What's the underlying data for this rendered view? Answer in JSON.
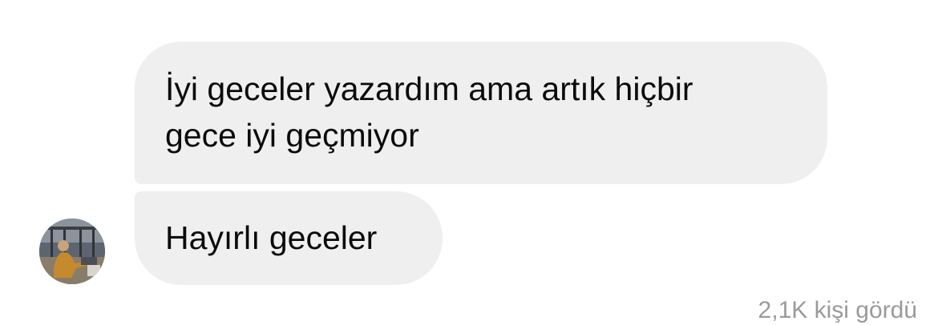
{
  "messages": [
    {
      "text_line_1": "İyi geceler yazardım ama artık hiçbir",
      "text_line_2": "gece iyi geçmiyor"
    },
    {
      "text": "Hayırlı geceler"
    }
  ],
  "sender": {
    "avatar_icon": "person-photo"
  },
  "footer": {
    "seen_text": "2,1K kişi gördü"
  },
  "colors": {
    "bubble_bg": "#efefef",
    "text": "#0b0b0b",
    "seen_text": "#9a9a9a",
    "background": "#ffffff"
  }
}
